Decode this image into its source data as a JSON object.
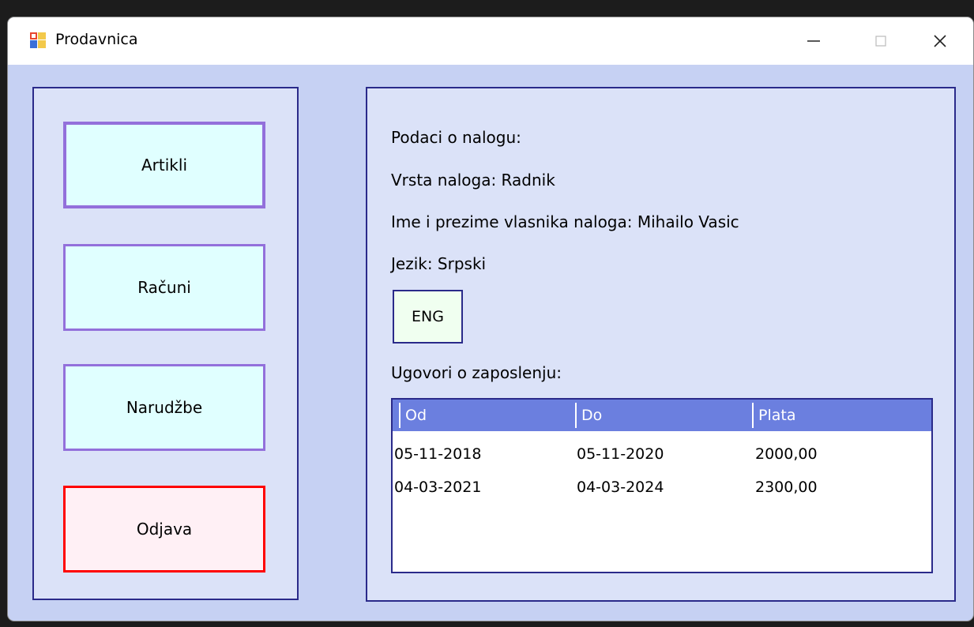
{
  "window": {
    "title": "Prodavnica"
  },
  "nav": {
    "artikli": "Artikli",
    "racuni": "Računi",
    "narudzbe": "Narudžbe",
    "odjava": "Odjava"
  },
  "account": {
    "heading": "Podaci o nalogu:",
    "type_line": "Vrsta naloga: Radnik",
    "owner_line": "Ime i prezime vlasnika naloga: Mihailo Vasic",
    "language_line": "Jezik: Srpski",
    "lang_button": "ENG"
  },
  "contracts": {
    "heading": "Ugovori o zaposlenju:",
    "columns": [
      "Od",
      "Do",
      "Plata"
    ],
    "rows": [
      [
        "05-11-2018",
        "05-11-2020",
        "2000,00"
      ],
      [
        "04-03-2021",
        "04-03-2024",
        "2300,00"
      ]
    ]
  },
  "colors": {
    "window_bg": "#c6d1f3",
    "panel_bg": "#dbe2f8",
    "nav_border": "#9370db",
    "nav_bg": "#e0ffff",
    "logout_border": "#ff0000",
    "logout_bg": "#fff0f5",
    "grid_header": "#6b7fdf"
  }
}
